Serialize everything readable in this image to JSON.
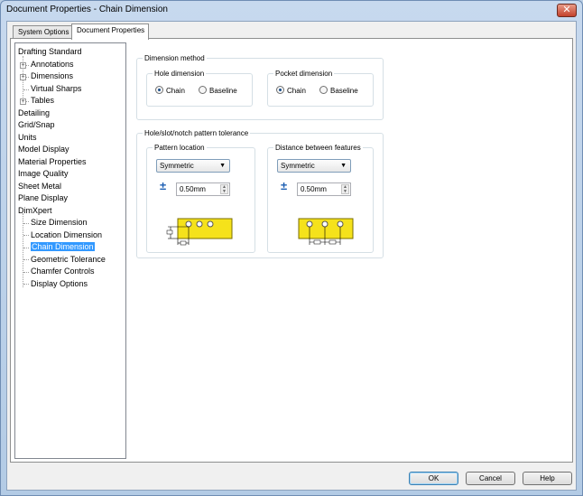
{
  "window": {
    "title": "Document Properties - Chain Dimension",
    "close_glyph": "✕"
  },
  "tabs": [
    {
      "label": "System Options",
      "active": false
    },
    {
      "label": "Document Properties",
      "active": true
    }
  ],
  "tree": {
    "items": [
      {
        "label": "Drafting Standard",
        "expander": ""
      },
      {
        "label": "Annotations",
        "expander": "+"
      },
      {
        "label": "Dimensions",
        "expander": "+"
      },
      {
        "label": "Virtual Sharps",
        "expander": ""
      },
      {
        "label": "Tables",
        "expander": "+"
      },
      {
        "label": "Detailing",
        "expander": ""
      },
      {
        "label": "Grid/Snap",
        "expander": ""
      },
      {
        "label": "Units",
        "expander": ""
      },
      {
        "label": "Model Display",
        "expander": ""
      },
      {
        "label": "Material Properties",
        "expander": ""
      },
      {
        "label": "Image Quality",
        "expander": ""
      },
      {
        "label": "Sheet Metal",
        "expander": ""
      },
      {
        "label": "Plane Display",
        "expander": ""
      },
      {
        "label": "DimXpert",
        "expander": ""
      },
      {
        "label": "Size Dimension",
        "expander": ""
      },
      {
        "label": "Location Dimension",
        "expander": ""
      },
      {
        "label": "Chain Dimension",
        "expander": "",
        "selected": true
      },
      {
        "label": "Geometric Tolerance",
        "expander": ""
      },
      {
        "label": "Chamfer Controls",
        "expander": ""
      },
      {
        "label": "Display Options",
        "expander": ""
      }
    ]
  },
  "dimension_method": {
    "title": "Dimension method",
    "hole": {
      "title": "Hole dimension",
      "options": [
        "Chain",
        "Baseline"
      ],
      "selected": "Chain"
    },
    "pocket": {
      "title": "Pocket dimension",
      "options": [
        "Chain",
        "Baseline"
      ],
      "selected": "Chain"
    }
  },
  "pattern_tolerance": {
    "title": "Hole/slot/notch pattern tolerance",
    "pattern_location": {
      "title": "Pattern location",
      "type": "Symmetric",
      "pm_symbol": "±",
      "value": "0.50mm"
    },
    "distance_between": {
      "title": "Distance between features",
      "type": "Symmetric",
      "pm_symbol": "±",
      "value": "0.50mm"
    }
  },
  "combo_arrow": "▼",
  "spin_up": "▲",
  "spin_down": "▼",
  "buttons": {
    "ok": "OK",
    "cancel": "Cancel",
    "help": "Help"
  },
  "colors": {
    "selection": "#3399ff",
    "preview_fill": "#f5e21b",
    "tolerance_icon": "#1d5fb3"
  }
}
